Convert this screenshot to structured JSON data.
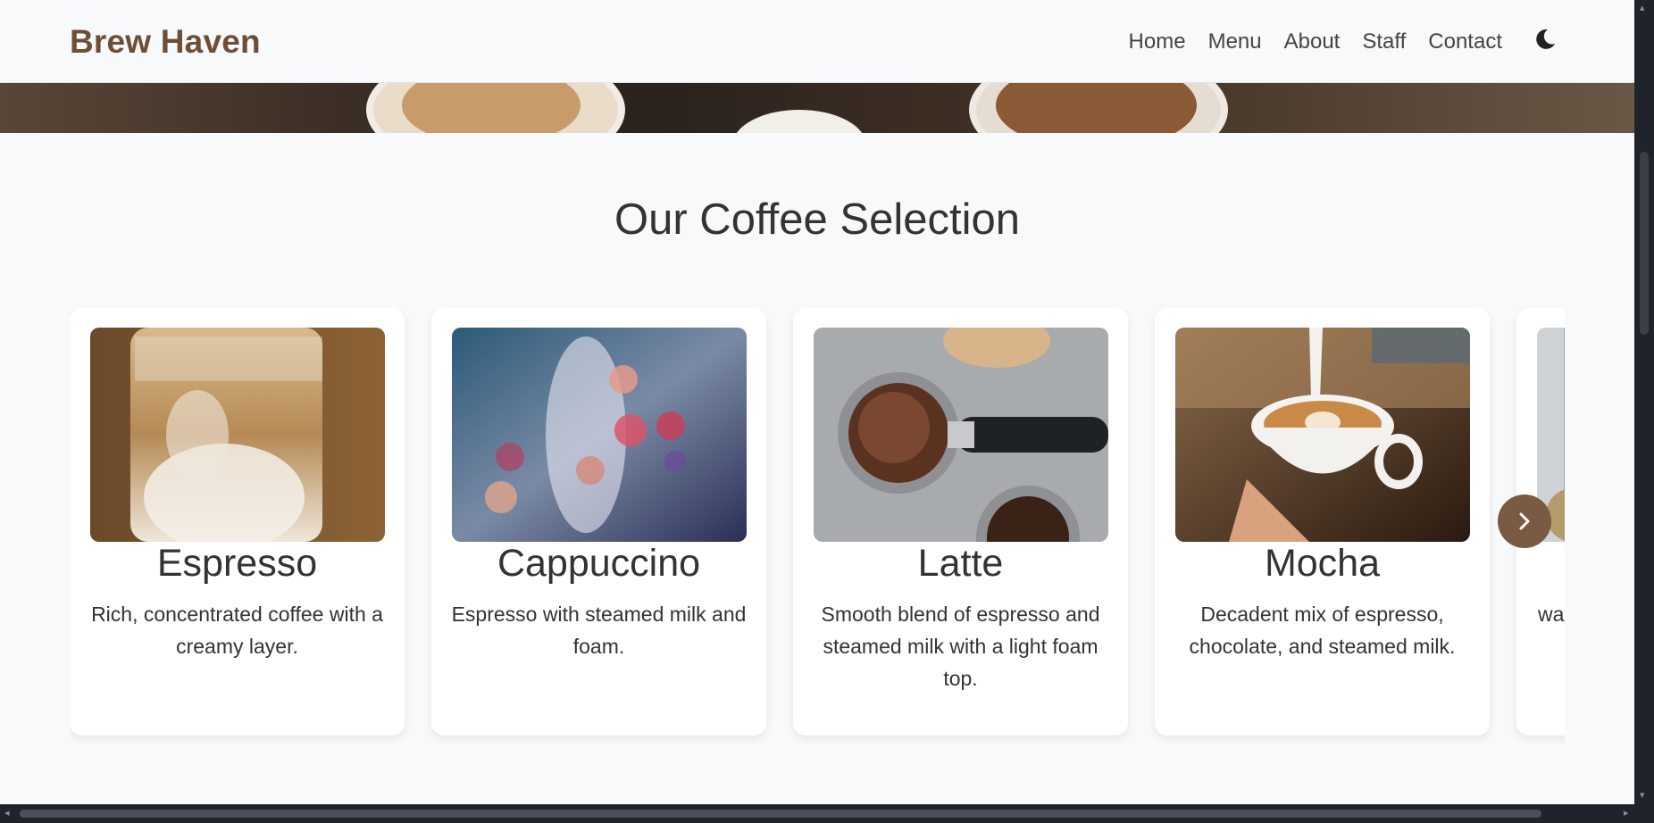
{
  "header": {
    "brand": "Brew Haven",
    "nav": [
      "Home",
      "Menu",
      "About",
      "Staff",
      "Contact"
    ],
    "theme_toggle_icon": "moon-icon"
  },
  "section": {
    "title": "Our Coffee Selection"
  },
  "cards": [
    {
      "title": "Espresso",
      "description": "Rich, concentrated coffee with a creamy layer."
    },
    {
      "title": "Cappuccino",
      "description": "Espresso with steamed milk and foam."
    },
    {
      "title": "Latte",
      "description": "Smooth blend of espresso and steamed milk with a light foam top."
    },
    {
      "title": "Mocha",
      "description": "Decadent mix of espresso, chocolate, and steamed milk."
    },
    {
      "title": "",
      "description": "wa"
    }
  ],
  "carousel": {
    "next_icon": "chevron-right-icon"
  },
  "colors": {
    "brand": "#6f4e37",
    "button": "#7b5a44",
    "background": "#f8f9fb"
  }
}
